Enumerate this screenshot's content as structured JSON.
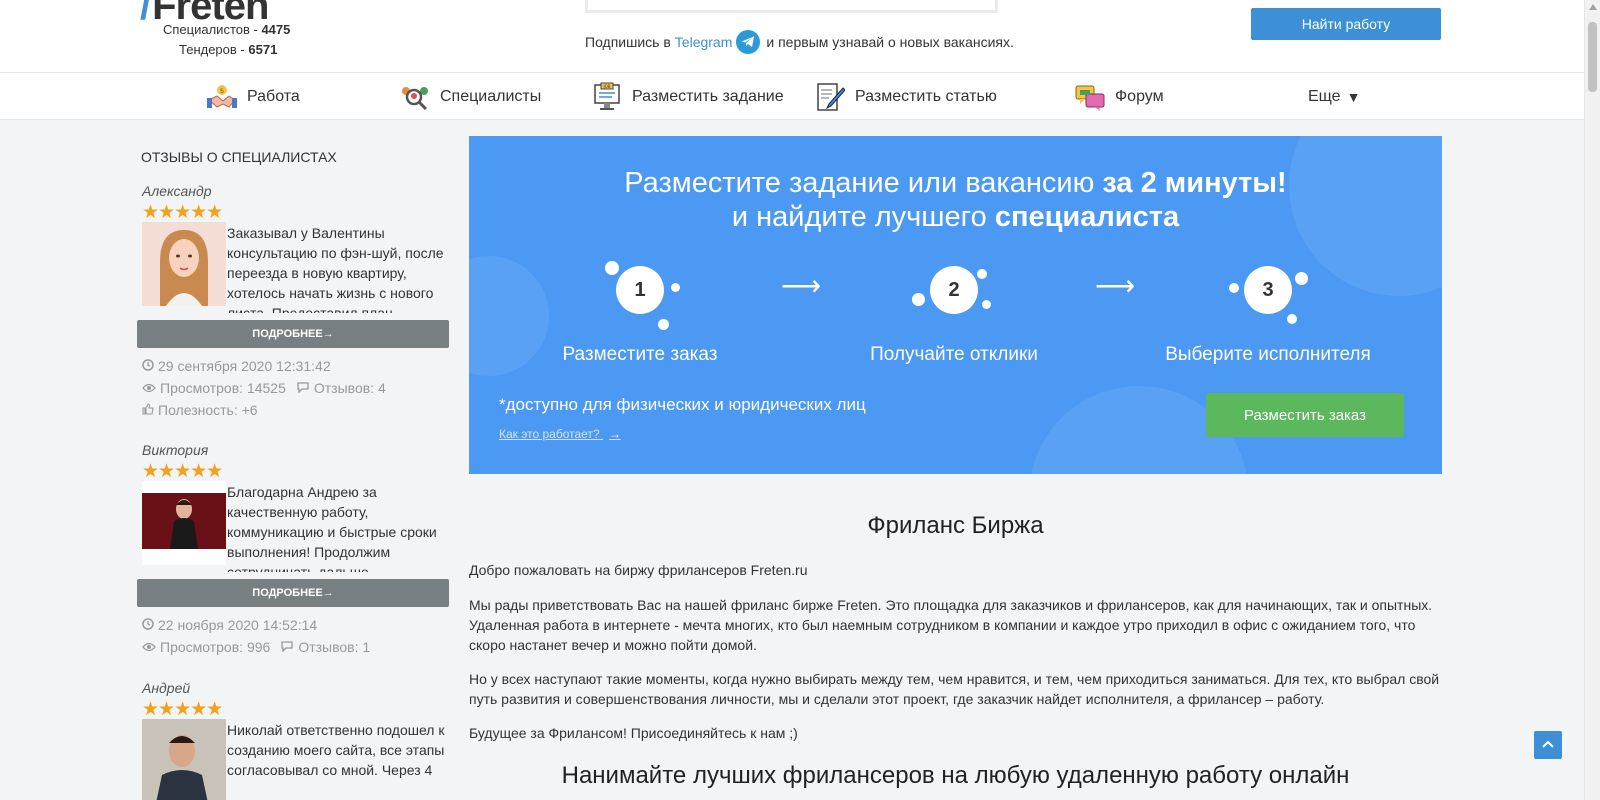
{
  "header": {
    "logo_text": "Freten",
    "specialists_label": "Специалистов -",
    "specialists_count": "4475",
    "tenders_label": "Тендеров -",
    "tenders_count": "6571",
    "subscribe_prefix": "Подпишись в",
    "subscribe_link": "Telegram",
    "subscribe_suffix": "и первым узнавай о новых вакансиях.",
    "find_job_label": "Найти работу",
    "accent_color": "#3d8fd6"
  },
  "nav": {
    "items": [
      {
        "label": "Работа",
        "icon": "handshake-icon"
      },
      {
        "label": "Специалисты",
        "icon": "people-search-icon"
      },
      {
        "label": "Разместить задание",
        "icon": "job-board-icon"
      },
      {
        "label": "Разместить статью",
        "icon": "article-pen-icon"
      },
      {
        "label": "Форум",
        "icon": "forum-chat-icon"
      },
      {
        "label": "Еще",
        "icon": "dropdown-triangle-icon"
      }
    ]
  },
  "sidebar": {
    "title": "ОТЗЫВЫ О СПЕЦИАЛИСТАХ",
    "more_label": "ПОДРОБНЕЕ→",
    "reviews": [
      {
        "name": "Александр",
        "stars": "★★★★★",
        "text": "Заказывал у Валентины консультацию по фэн-шуй, после переезда в новую квартиру, хотелось начать жизнь с нового листа. Предоставил план",
        "date": "29 сентября 2020 12:31:42",
        "views": "Просмотров: 14525",
        "reviews": "Отзывов: 4",
        "usefulness": "Полезность: +6"
      },
      {
        "name": "Виктория",
        "stars": "★★★★★",
        "text": "Благодарна Андрею за качественную работу, коммуникацию и быстрые сроки выполнения! Продолжим сотрудничать дальше.",
        "date": "22 ноября 2020 14:52:14",
        "views": "Просмотров: 996",
        "reviews": "Отзывов: 1"
      },
      {
        "name": "Андрей",
        "stars": "★★★★★",
        "text": "Николай ответственно подошел к созданию моего сайта, все этапы согласовывал со мной. Через 4"
      }
    ]
  },
  "banner": {
    "title_line1_normal": "Разместите задание или вакансию ",
    "title_line1_bold": "за 2 минуты!",
    "title_line2_normal": "и найдите лучшего ",
    "title_line2_bold": "специалиста",
    "steps": [
      {
        "num": "1",
        "label": "Разместите заказ"
      },
      {
        "num": "2",
        "label": "Получайте отклики"
      },
      {
        "num": "3",
        "label": "Выберите исполнителя"
      }
    ],
    "availability": "*доступно для физических и юридических лиц",
    "how_link": "Как это работает?",
    "place_order_label": "Разместить заказ",
    "bg_color": "#4b99f3",
    "button_color": "#5cb85c"
  },
  "main": {
    "heading": "Фриланс Биржа",
    "p1": "Добро пожаловать на биржу фрилансеров Freten.ru",
    "p2": "Мы рады приветствовать Вас на нашей фриланс бирже Freten. Это площадка для заказчиков и фрилансеров, как для начинающих, так и опытных. Удаленная работа в интернете - мечта многих, кто был наемным сотрудником в компании и каждое утро приходил в офис с ожиданием того, что скоро настанет вечер и можно пойти домой.",
    "p3": "Но у всех наступают такие моменты, когда нужно выбирать между тем, чем нравится, и тем, чем приходиться заниматься. Для тех, кто выбрал свой путь развития и совершенствования личности, мы и сделали этот проект, где заказчик найдет исполнителя, а фрилансер – работу.",
    "p4": "Будущее за Фрилансом! Присоединяйтесь к нам ;)",
    "subheading": "Нанимайте лучших фрилансеров на любую удаленную работу онлайн"
  }
}
